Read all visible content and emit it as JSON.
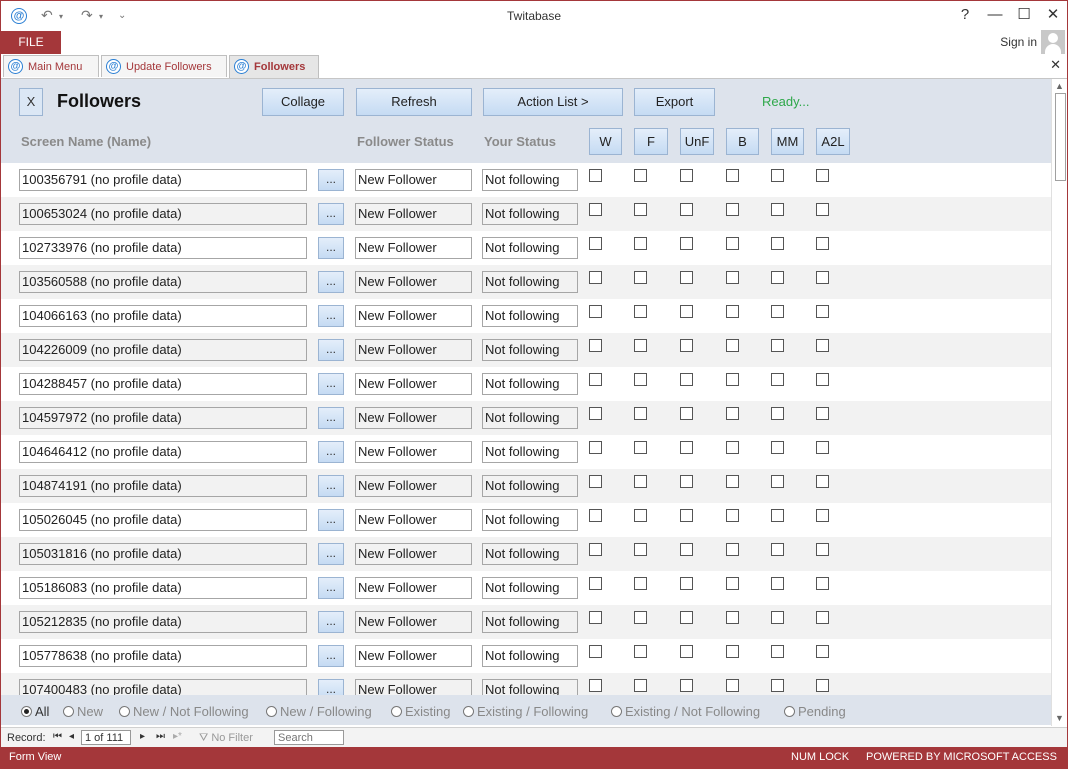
{
  "window": {
    "title": "Twitabase",
    "app_icon": "at-icon",
    "controls": [
      "?",
      "—",
      "☐",
      "✕"
    ]
  },
  "ribbon": {
    "file_label": "FILE",
    "signin_label": "Sign in"
  },
  "tabs": [
    {
      "label": "Main Menu",
      "active": false
    },
    {
      "label": "Update Followers",
      "active": false
    },
    {
      "label": "Followers",
      "active": true
    }
  ],
  "form": {
    "close_label": "X",
    "title": "Followers",
    "buttons": {
      "collage": "Collage",
      "refresh": "Refresh",
      "action_list": "Action List >",
      "export": "Export"
    },
    "status": "Ready...",
    "status_color": "#2ea84a",
    "columns": {
      "screen_name": "Screen Name (Name)",
      "follower_status": "Follower Status",
      "your_status": "Your Status"
    },
    "flags": [
      "W",
      "F",
      "UnF",
      "B",
      "MM",
      "A2L"
    ],
    "lookup_label": "...",
    "rows": [
      {
        "name": "100356791 (no profile data)",
        "follower": "New Follower",
        "yours": "Not following"
      },
      {
        "name": "100653024 (no profile data)",
        "follower": "New Follower",
        "yours": "Not following"
      },
      {
        "name": "102733976 (no profile data)",
        "follower": "New Follower",
        "yours": "Not following"
      },
      {
        "name": "103560588 (no profile data)",
        "follower": "New Follower",
        "yours": "Not following"
      },
      {
        "name": "104066163 (no profile data)",
        "follower": "New Follower",
        "yours": "Not following"
      },
      {
        "name": "104226009 (no profile data)",
        "follower": "New Follower",
        "yours": "Not following"
      },
      {
        "name": "104288457 (no profile data)",
        "follower": "New Follower",
        "yours": "Not following"
      },
      {
        "name": "104597972 (no profile data)",
        "follower": "New Follower",
        "yours": "Not following"
      },
      {
        "name": "104646412 (no profile data)",
        "follower": "New Follower",
        "yours": "Not following"
      },
      {
        "name": "104874191 (no profile data)",
        "follower": "New Follower",
        "yours": "Not following"
      },
      {
        "name": "105026045 (no profile data)",
        "follower": "New Follower",
        "yours": "Not following"
      },
      {
        "name": "105031816 (no profile data)",
        "follower": "New Follower",
        "yours": "Not following"
      },
      {
        "name": "105186083 (no profile data)",
        "follower": "New Follower",
        "yours": "Not following"
      },
      {
        "name": "105212835 (no profile data)",
        "follower": "New Follower",
        "yours": "Not following"
      },
      {
        "name": "105778638 (no profile data)",
        "follower": "New Follower",
        "yours": "Not following"
      },
      {
        "name": "107400483 (no profile data)",
        "follower": "New Follower",
        "yours": "Not following"
      }
    ],
    "filters": [
      {
        "label": "All",
        "selected": true
      },
      {
        "label": "New",
        "selected": false
      },
      {
        "label": "New / Not Following",
        "selected": false
      },
      {
        "label": "New / Following",
        "selected": false
      },
      {
        "label": "Existing",
        "selected": false
      },
      {
        "label": "Existing / Following",
        "selected": false
      },
      {
        "label": "Existing / Not Following",
        "selected": false
      },
      {
        "label": "Pending",
        "selected": false
      }
    ]
  },
  "record_nav": {
    "record_label": "Record:",
    "position": "1 of 111",
    "no_filter_label": "No Filter",
    "search_placeholder": "Search"
  },
  "statusbar": {
    "view": "Form View",
    "num_lock": "NUM LOCK",
    "powered": "POWERED BY MICROSOFT ACCESS"
  },
  "colors": {
    "brand": "#a4373a",
    "header_bg": "#dde3ec",
    "button_border": "#9bb4d2"
  }
}
